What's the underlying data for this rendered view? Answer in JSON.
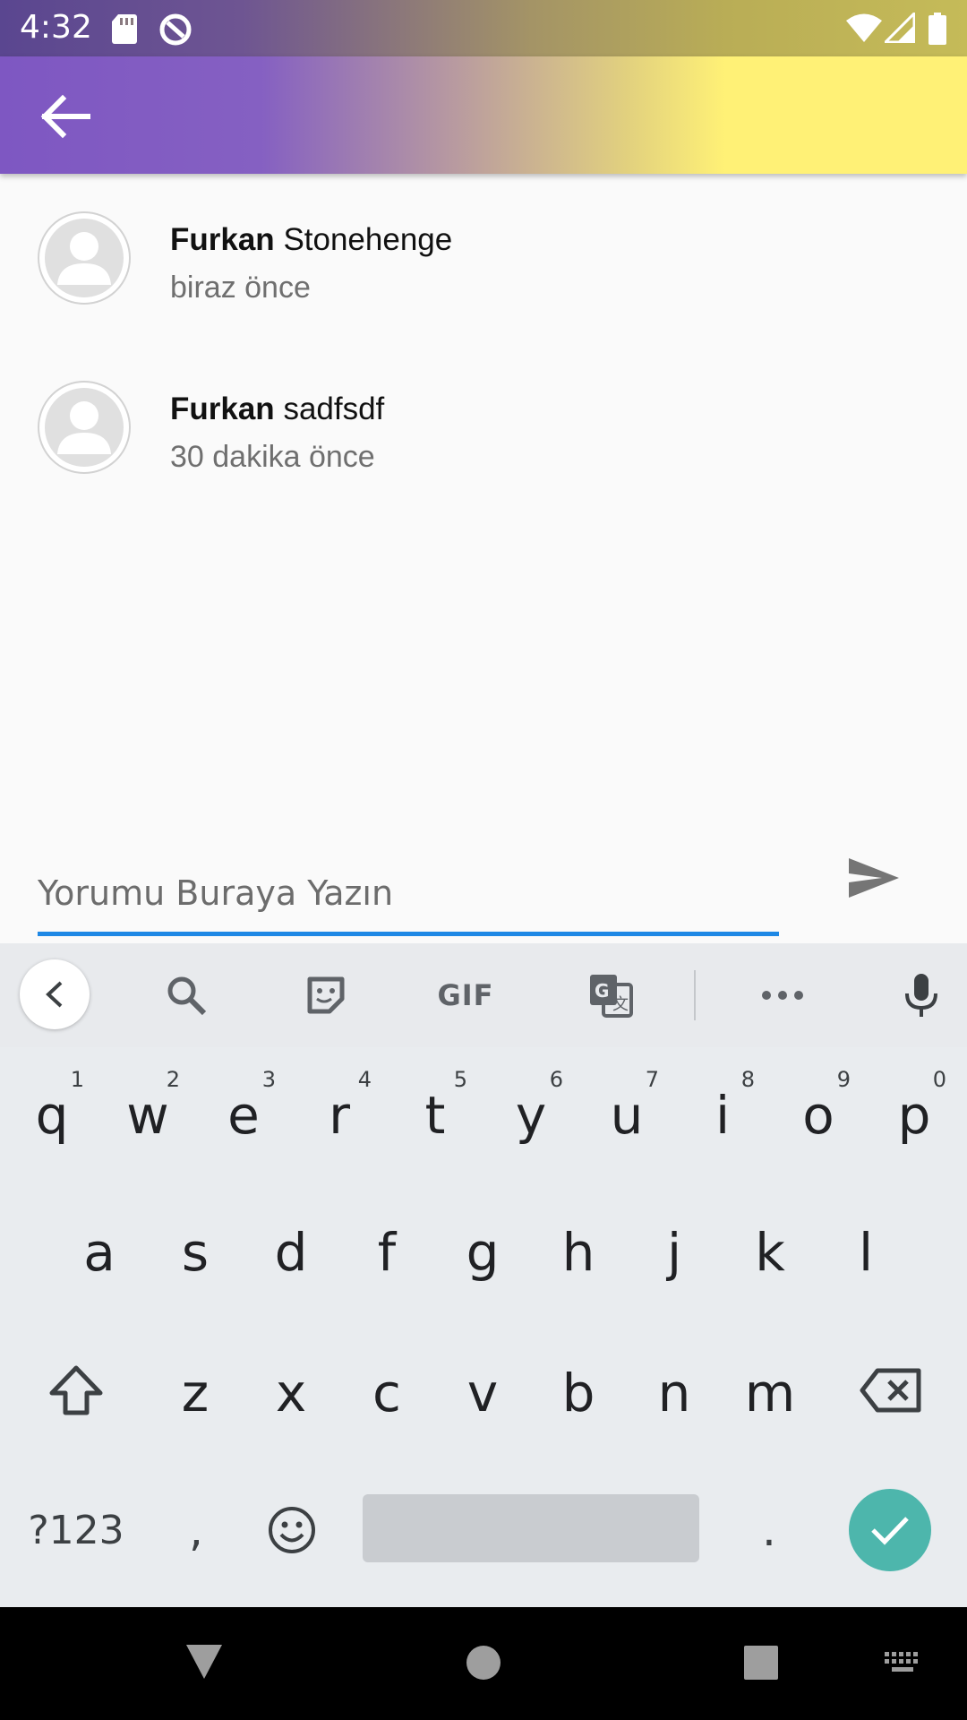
{
  "status_bar": {
    "time": "4:32",
    "icons": [
      "sd-card-icon",
      "sync-icon",
      "wifi-icon",
      "signal-icon",
      "battery-icon"
    ]
  },
  "app_bar": {
    "back_icon": "arrow-back-icon"
  },
  "comments": [
    {
      "author": "Furkan",
      "text": "Stonehenge",
      "time": "biraz önce"
    },
    {
      "author": "Furkan",
      "text": "sadfsdf",
      "time": "30 dakika önce"
    }
  ],
  "comment_input": {
    "placeholder": "Yorumu Buraya Yazın",
    "value": ""
  },
  "send_icon": "send-icon",
  "colors": {
    "accent_underline": "#1e88e5",
    "appbar_start": "#7e57c2",
    "appbar_end": "#fff176",
    "enter_key": "#4db6ac"
  },
  "keyboard": {
    "toolbar": [
      "collapse-icon",
      "search-icon",
      "sticker-icon",
      "gif-icon",
      "translate-icon",
      "more-icon",
      "mic-icon"
    ],
    "gif_label": "GIF",
    "row1": [
      {
        "ch": "q",
        "hint": "1"
      },
      {
        "ch": "w",
        "hint": "2"
      },
      {
        "ch": "e",
        "hint": "3"
      },
      {
        "ch": "r",
        "hint": "4"
      },
      {
        "ch": "t",
        "hint": "5"
      },
      {
        "ch": "y",
        "hint": "6"
      },
      {
        "ch": "u",
        "hint": "7"
      },
      {
        "ch": "i",
        "hint": "8"
      },
      {
        "ch": "o",
        "hint": "9"
      },
      {
        "ch": "p",
        "hint": "0"
      }
    ],
    "row2": [
      "a",
      "s",
      "d",
      "f",
      "g",
      "h",
      "j",
      "k",
      "l"
    ],
    "row3": [
      "z",
      "x",
      "c",
      "v",
      "b",
      "n",
      "m"
    ],
    "symbols_label": "?123",
    "comma_label": ",",
    "period_label": "."
  },
  "nav_bar": {
    "icons": [
      "back-triangle-icon",
      "home-circle-icon",
      "recents-square-icon",
      "keyboard-switch-icon"
    ]
  }
}
